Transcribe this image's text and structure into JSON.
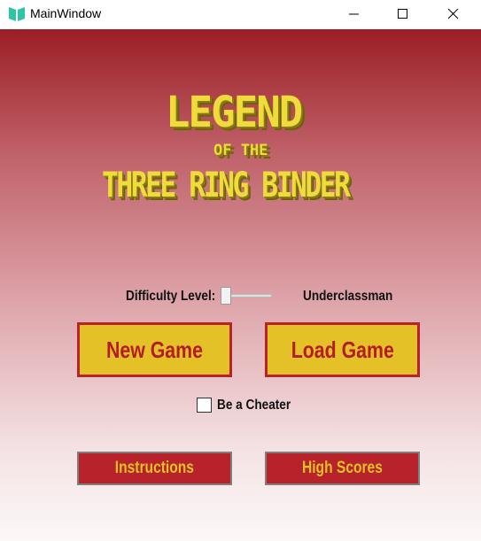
{
  "window": {
    "title": "MainWindow",
    "icon": "app-logo-icon",
    "controls": [
      "minimize-icon",
      "maximize-icon",
      "close-icon"
    ]
  },
  "logo": {
    "line1": "LEGEND",
    "line2": "OF THE",
    "line3": "THREE RING BINDER"
  },
  "difficulty": {
    "label": "Difficulty Level:",
    "value": "Underclassman",
    "slider_level": 0
  },
  "buttons": {
    "new_game": "New Game",
    "load_game": "Load Game",
    "instructions": "Instructions",
    "high_scores": "High Scores"
  },
  "cheater": {
    "label": "Be a Cheater",
    "checked": false
  },
  "colors": {
    "top_red": "#9b1e25",
    "button_yellow": "#e4c126",
    "button_red": "#b8222b",
    "logo_yellow": "#f0db3c",
    "icon_teal": "#2ec4a6"
  }
}
